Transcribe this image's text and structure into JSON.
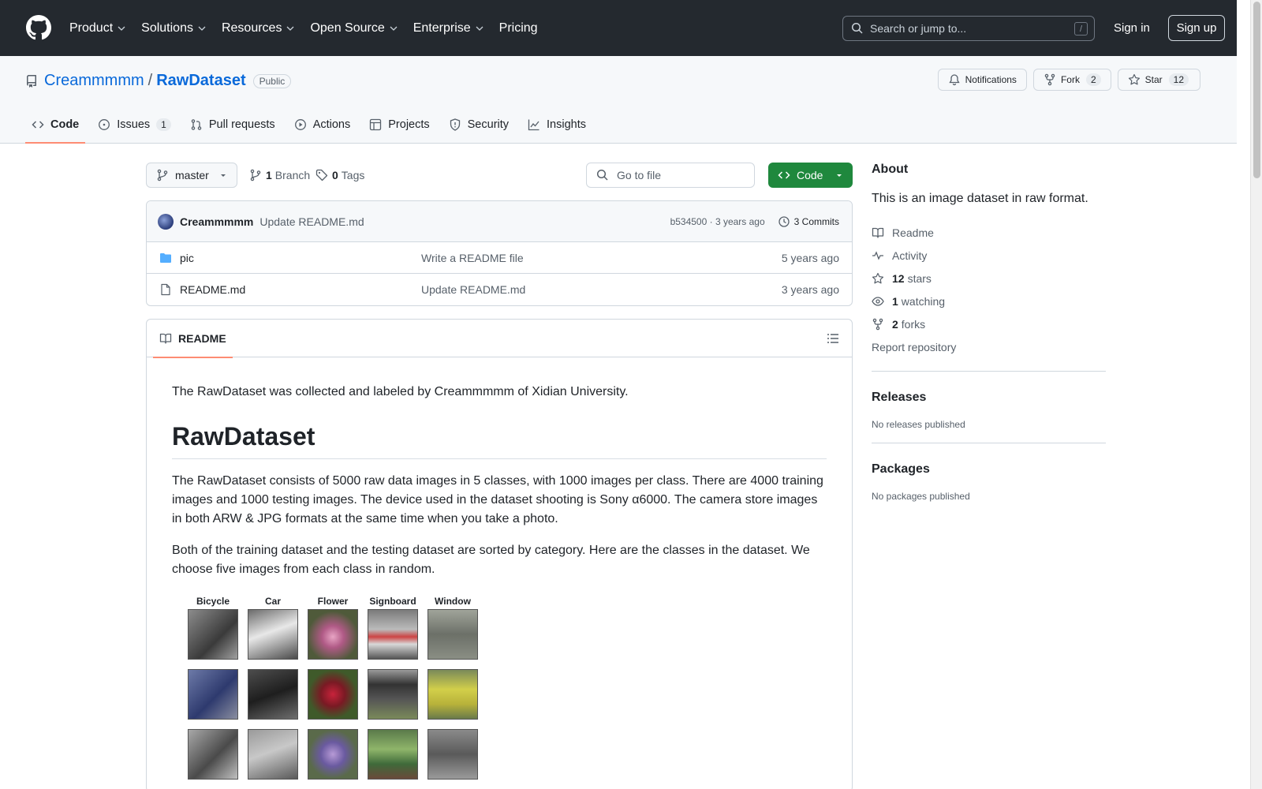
{
  "nav": {
    "items": [
      "Product",
      "Solutions",
      "Resources",
      "Open Source",
      "Enterprise",
      "Pricing"
    ],
    "search_placeholder": "Search or jump to...",
    "search_shortcut": "/",
    "sign_in": "Sign in",
    "sign_up": "Sign up"
  },
  "repo": {
    "owner": "Creammmmm",
    "separator": "/",
    "name": "RawDataset",
    "visibility": "Public",
    "notifications": "Notifications",
    "fork_label": "Fork",
    "fork_count": "2",
    "star_label": "Star",
    "star_count": "12"
  },
  "tabs": [
    {
      "label": "Code"
    },
    {
      "label": "Issues",
      "count": "1"
    },
    {
      "label": "Pull requests"
    },
    {
      "label": "Actions"
    },
    {
      "label": "Projects"
    },
    {
      "label": "Security"
    },
    {
      "label": "Insights"
    }
  ],
  "toolbar": {
    "branch": "master",
    "branch_count": "1",
    "branch_label": "Branch",
    "tag_count": "0",
    "tag_label": "Tags",
    "goto_placeholder": "Go to file",
    "code_button": "Code"
  },
  "commit": {
    "author": "Creammmmm",
    "message": "Update README.md",
    "sha_time": "b534500 · 3 years ago",
    "commits": "3 Commits"
  },
  "files": [
    {
      "name": "pic",
      "message": "Write a README file",
      "age": "5 years ago",
      "type": "folder"
    },
    {
      "name": "README.md",
      "message": "Update README.md",
      "age": "3 years ago",
      "type": "file"
    }
  ],
  "readme": {
    "tab": "README",
    "intro": "The RawDataset was collected and labeled by Creammmmm of Xidian University.",
    "heading": "RawDataset",
    "p1": "The RawDataset consists of 5000 raw data images in 5 classes, with 1000 images per class. There are 4000 training images and 1000 testing images. The device used in the dataset shooting is Sony α6000. The camera store images in both ARW & JPG formats at the same time when you take a photo.",
    "p2": "Both of the training dataset and the testing dataset are sorted by category. Here are the classes in the dataset. We choose five images from each class in random.",
    "classes": [
      "Bicycle",
      "Car",
      "Flower",
      "Signboard",
      "Window"
    ]
  },
  "about": {
    "heading": "About",
    "description": "This is an image dataset in raw format.",
    "readme": "Readme",
    "activity": "Activity",
    "stars_count": "12",
    "stars_label": "stars",
    "watching_count": "1",
    "watching_label": "watching",
    "forks_count": "2",
    "forks_label": "forks",
    "report": "Report repository"
  },
  "releases": {
    "heading": "Releases",
    "text": "No releases published"
  },
  "packages": {
    "heading": "Packages",
    "text": "No packages published"
  },
  "colors": {
    "header_bg": "#24292f",
    "link": "#0969da",
    "code_button": "#1f883d",
    "tab_underline": "#fd8c73"
  }
}
